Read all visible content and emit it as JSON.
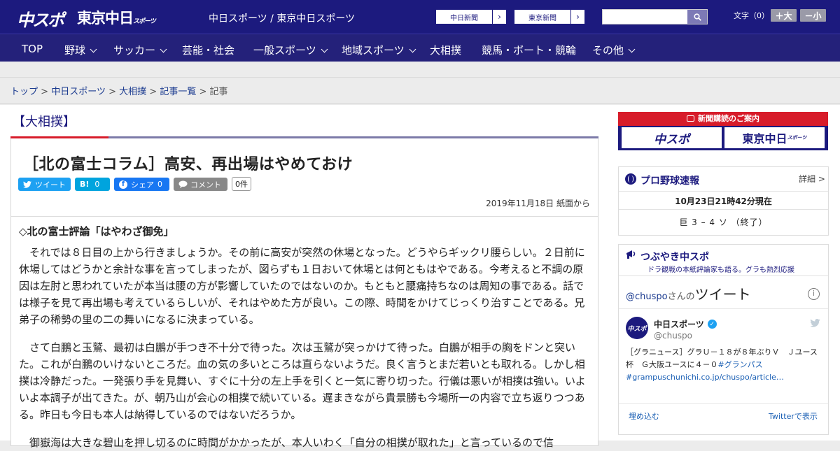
{
  "header": {
    "logo_chunichi": "中スポ",
    "logo_tokyo": "東京中日",
    "logo_tokyo_small": "スポーツ",
    "site_name": "中日スポーツ / 東京中日スポーツ",
    "partner_links": [
      {
        "label": "中日新聞"
      },
      {
        "label": "東京新聞"
      }
    ],
    "search_placeholder": "",
    "font_size_label": "文字（0）",
    "font_larger": "＋大",
    "font_smaller": "－小"
  },
  "nav": {
    "items": [
      {
        "label": "TOP",
        "dropdown": false
      },
      {
        "label": "野球",
        "dropdown": true
      },
      {
        "label": "サッカー",
        "dropdown": true
      },
      {
        "label": "芸能・社会",
        "dropdown": false
      },
      {
        "label": "一般スポーツ",
        "dropdown": true
      },
      {
        "label": "地域スポーツ",
        "dropdown": true
      },
      {
        "label": "大相撲",
        "dropdown": false
      },
      {
        "label": "競馬・ボート・競輪",
        "dropdown": false
      },
      {
        "label": "その他",
        "dropdown": true
      }
    ]
  },
  "breadcrumb": {
    "items": [
      "トップ",
      "中日スポーツ",
      "大相撲",
      "記事一覧"
    ],
    "separator": ">",
    "current": "記事"
  },
  "article": {
    "category": "【大相撲】",
    "title": "［北の富士コラム］高安、再出場はやめておけ",
    "share": {
      "tweet": "ツイート",
      "hatena": "B!",
      "hatena_count": "0",
      "facebook": "シェア",
      "facebook_count": "0",
      "comment": "コメント",
      "comment_count": "0件"
    },
    "date": "2019年11月18日 紙面から",
    "subheading": "◇北の富士評論「はやわざ御免」",
    "paragraphs": [
      "それでは８日目の上から行きましょうか。その前に高安が突然の休場となった。どうやらギックリ腰らしい。２日前に休場してはどうかと余計な事を言ってしまったが、図らずも１日おいて休場とは何ともはやである。今考えると不調の原因は左肘と思われていたが本当は腰の方が影響していたのではないのか。もともと腰痛持ちなのは周知の事である。話では様子を見て再出場も考えているらしいが、それはやめた方が良い。この際、時間をかけてじっくり治すことである。兄弟子の稀勢の里の二の舞いになるに決まっている。",
      "さて白鵬と玉鷲、最初は白鵬が手つき不十分で待った。次は玉鷲が突っかけて待った。白鵬が相手の胸をドンと突いた。これが白鵬のいけないところだ。血の気の多いところは直らないようだ。良く言うとまだ若いとも取れる。しかし相撲は冷静だった。一発張り手を見舞い、すぐに十分の左上手を引くと一気に寄り切った。行儀は悪いが相撲は強い。いよいよ本調子が出てきた。が、朝乃山が会心の相撲で続いている。遅まきながら貴景勝も今場所一の内容で立ち返りつつある。昨日も今日も本人は納得しているのではないだろうか。",
      "御嶽海は大きな碧山を押し切るのに時間がかかったが、本人いわく「自分の相撲が取れた」と言っているので信"
    ]
  },
  "sidebar": {
    "promo": {
      "header": "新聞購読のご案内",
      "btn1": "中スポ",
      "btn2": "東京中日",
      "btn2_small": "スポーツ"
    },
    "baseball": {
      "title": "プロ野球速報",
      "detail_link": "詳細 >",
      "timestamp": "10月23日21時42分現在",
      "score": "巨 3 – 4 ソ （終了）"
    },
    "tsubuyaki": {
      "title": "つぶやき中スポ",
      "subtitle": "ドラ観戦の本紙評論家も語る。グラも熱烈応援",
      "handle_link": "@chuspo",
      "handle_suffix": "さんの",
      "tweets_label": "ツイート",
      "account_name": "中日スポーツ",
      "account_handle": "@chuspo",
      "avatar_text": "中スポ",
      "tweet_text": "［グラニュース］グラＵ－１８が８年ぶりＶ　Ｊユース杯　Ｇ大阪ユースに４－０",
      "tweet_hashtag": "#グランパス",
      "tweet_link": "#grampuschunichi.co.jp/chuspo/article…",
      "embed": "埋め込む",
      "view_on_twitter": "Twitterで表示"
    }
  },
  "colors": {
    "brand_navy": "#1c1a7e",
    "accent_red": "#d71c2a",
    "twitter_blue": "#1da1f2",
    "hatena_blue": "#00a4de",
    "facebook_blue": "#1877f2",
    "link_blue": "#1a3a8f"
  }
}
